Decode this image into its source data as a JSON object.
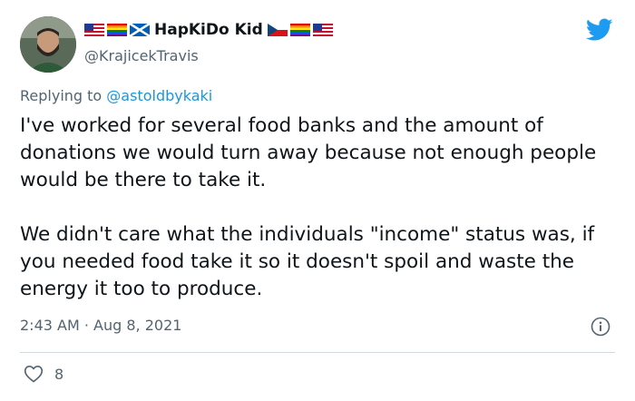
{
  "author": {
    "display_name": "HapKiDo Kid",
    "handle": "@KrajicekTravis",
    "avatar_icon": "profile-photo",
    "name_flags_before": [
      "us-flag-icon",
      "rainbow-flag-icon",
      "scotland-flag-icon"
    ],
    "name_flags_after": [
      "czech-flag-icon",
      "rainbow-flag-icon",
      "us-flag-icon"
    ]
  },
  "platform_icon": "twitter-bird-icon",
  "reply": {
    "prefix": "Replying to ",
    "mention": "@astoldbykaki"
  },
  "tweet": {
    "paragraph_1": "I've worked for several food banks and the amount of donations we would turn away because not enough people would be there to take it.",
    "paragraph_2": "We didn't care what the individuals \"income\" status was, if you needed food take it so it doesn't spoil and waste the energy it too to produce."
  },
  "meta": {
    "timestamp": "2:43 AM · Aug 8, 2021",
    "info_icon": "info-icon"
  },
  "engagement": {
    "like_icon": "heart-icon",
    "like_count": "8"
  },
  "colors": {
    "link": "#1b95e0",
    "secondary_text": "#536471",
    "twitter_blue": "#1d9bf0",
    "divider": "#cfd9de"
  }
}
